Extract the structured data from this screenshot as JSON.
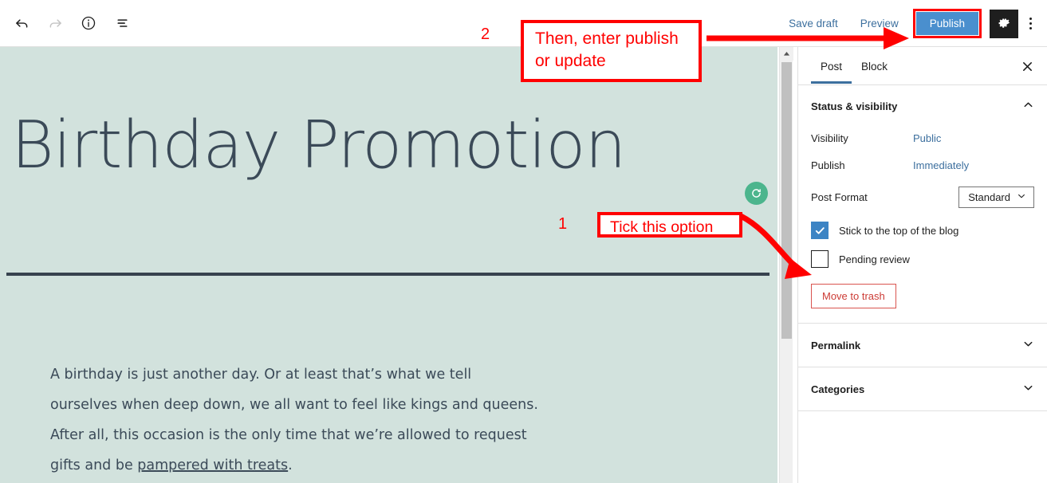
{
  "toolbar": {
    "undo_icon": "undo-arrow-icon",
    "redo_icon": "redo-arrow-icon",
    "info_icon": "info-circle-icon",
    "list_view_icon": "list-view-icon",
    "save_draft_label": "Save draft",
    "preview_label": "Preview",
    "publish_label": "Publish",
    "settings_icon": "gear-icon",
    "more_options_icon": "kebab-menu-icon"
  },
  "editor": {
    "title": "Birthday Promotion",
    "body_line_1": "A birthday is just another day. Or at least that’s what we tell",
    "body_line_2": "ourselves when deep down, we all want to feel like kings and queens.",
    "body_line_3": "After all, this occasion is the only time that we’re allowed to request",
    "body_line_4_pre": "gifts and be ",
    "body_line_4_link": "pampered with treats",
    "body_line_4_post": ".",
    "assistant_badge_icon": "grammarly-refresh-icon",
    "background_color": "#d2e2dd",
    "text_color": "#3b4a58"
  },
  "scrollbar": {
    "up_arrow_icon": "scroll-up-arrow-icon"
  },
  "sidebar": {
    "tabs": [
      {
        "label": "Post",
        "active": true
      },
      {
        "label": "Block",
        "active": false
      }
    ],
    "close_icon": "close-icon",
    "status_section": {
      "title": "Status & visibility",
      "chevron_icon": "chevron-up-icon",
      "rows": [
        {
          "label": "Visibility",
          "value": "Public"
        },
        {
          "label": "Publish",
          "value": "Immediately"
        }
      ],
      "post_format": {
        "label": "Post Format",
        "value": "Standard",
        "chevron_icon": "chevron-down-icon"
      },
      "checkboxes": [
        {
          "label": "Stick to the top of the blog",
          "checked": true
        },
        {
          "label": "Pending review",
          "checked": false
        }
      ],
      "trash_label": "Move to trash"
    },
    "panels": [
      {
        "label": "Permalink",
        "chevron_icon": "chevron-down-icon"
      },
      {
        "label": "Categories",
        "chevron_icon": "chevron-down-icon"
      }
    ]
  },
  "annotations": {
    "step_1_number": "1",
    "step_1_text": "Tick this option",
    "step_2_number": "2",
    "step_2_text_line_1": "Then, enter publish",
    "step_2_text_line_2": "or update",
    "highlight_color": "#ff0000"
  }
}
